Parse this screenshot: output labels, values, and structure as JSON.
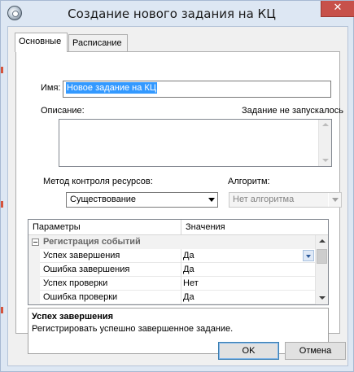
{
  "window": {
    "title": "Создание нового задания на КЦ",
    "close_glyph": "✕",
    "icon": "app-gear-icon"
  },
  "tabs": [
    {
      "label": "Основные",
      "active": true
    },
    {
      "label": "Расписание",
      "active": false
    }
  ],
  "form": {
    "name_label": "Имя:",
    "name_value": "Новое задание на КЦ",
    "description_label": "Описание:",
    "status_text": "Задание не запускалось",
    "description_value": "",
    "method_label": "Метод контроля ресурсов:",
    "method_value": "Существование",
    "algorithm_label": "Алгоритм:",
    "algorithm_value": "Нет алгоритма"
  },
  "grid": {
    "columns": [
      "Параметры",
      "Значения"
    ],
    "category": "Регистрация событий",
    "rows": [
      {
        "param": "Успех завершения",
        "value": "Да"
      },
      {
        "param": "Ошибка завершения",
        "value": "Да"
      },
      {
        "param": "Успех проверки",
        "value": "Нет"
      },
      {
        "param": "Ошибка проверки",
        "value": "Да"
      }
    ]
  },
  "description_panel": {
    "title": "Успех завершения",
    "text": "Регистрировать успешно завершенное задание."
  },
  "buttons": {
    "ok": "OK",
    "cancel": "Отмена"
  },
  "colors": {
    "selection": "#3399ff",
    "close_button": "#c7514a",
    "window_frame": "#dde7f3"
  }
}
